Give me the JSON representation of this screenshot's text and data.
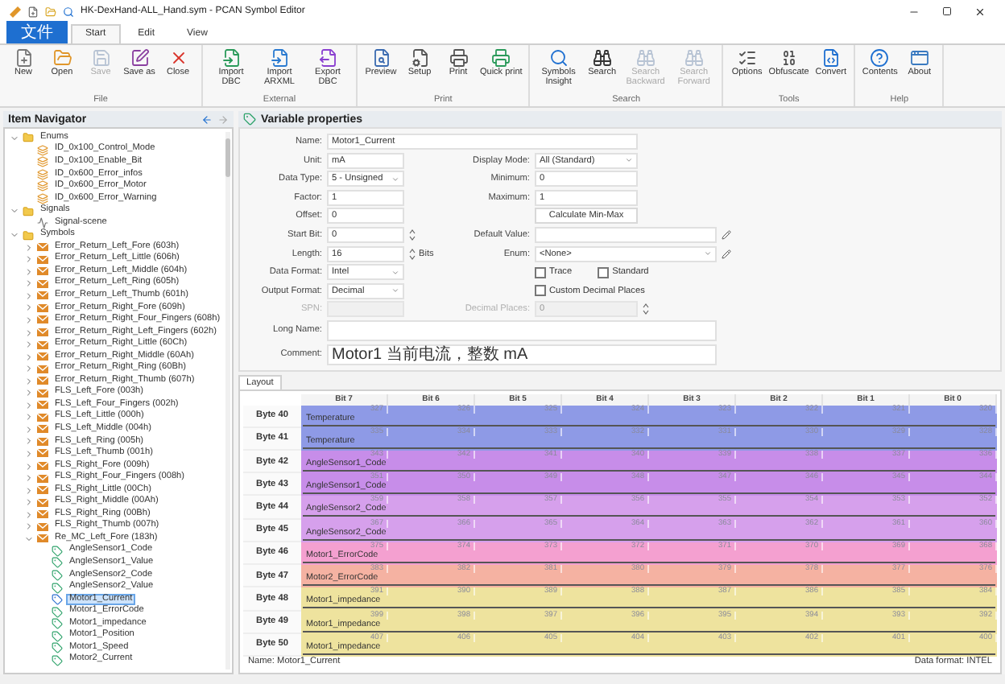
{
  "window": {
    "title": "HK-DexHand-ALL_Hand.sym - PCAN Symbol Editor"
  },
  "ribbon": {
    "tabs": [
      {
        "label": "文件",
        "kind": "file",
        "selected": false
      },
      {
        "label": "Start",
        "kind": "tab",
        "selected": true
      },
      {
        "label": "Edit",
        "kind": "tab",
        "selected": false
      },
      {
        "label": "View",
        "kind": "tab",
        "selected": false
      }
    ],
    "groups": [
      {
        "label": "File",
        "buttons": [
          {
            "label": "New",
            "disabled": false
          },
          {
            "label": "Open",
            "disabled": false
          },
          {
            "label": "Save",
            "disabled": true
          },
          {
            "label": "Save as",
            "disabled": false
          },
          {
            "label": "Close",
            "disabled": false
          }
        ]
      },
      {
        "label": "External",
        "buttons": [
          {
            "label": "Import DBC",
            "disabled": false
          },
          {
            "label": "Import ARXML",
            "disabled": false
          },
          {
            "label": "Export DBC",
            "disabled": false
          }
        ]
      },
      {
        "label": "Print",
        "buttons": [
          {
            "label": "Preview",
            "disabled": false
          },
          {
            "label": "Setup",
            "disabled": false
          },
          {
            "label": "Print",
            "disabled": false
          },
          {
            "label": "Quick print",
            "disabled": false
          }
        ]
      },
      {
        "label": "Search",
        "buttons": [
          {
            "label": "Symbols Insight",
            "disabled": false
          },
          {
            "label": "Search",
            "disabled": false
          },
          {
            "label": "Search Backward",
            "disabled": true
          },
          {
            "label": "Search Forward",
            "disabled": true
          }
        ]
      },
      {
        "label": "Tools",
        "buttons": [
          {
            "label": "Options",
            "disabled": false
          },
          {
            "label": "Obfuscate",
            "disabled": false
          },
          {
            "label": "Convert",
            "disabled": false
          }
        ]
      },
      {
        "label": "Help",
        "buttons": [
          {
            "label": "Contents",
            "disabled": false
          },
          {
            "label": "About",
            "disabled": false
          }
        ]
      }
    ]
  },
  "navigator": {
    "title": "Item Navigator",
    "tree": [
      {
        "label": "Enums",
        "kind": "folder",
        "expanded": true,
        "children": [
          {
            "label": "ID_0x100_Control_Mode",
            "kind": "enum"
          },
          {
            "label": "ID_0x100_Enable_Bit",
            "kind": "enum"
          },
          {
            "label": "ID_0x600_Error_infos",
            "kind": "enum"
          },
          {
            "label": "ID_0x600_Error_Motor",
            "kind": "enum"
          },
          {
            "label": "ID_0x600_Error_Warning",
            "kind": "enum"
          }
        ]
      },
      {
        "label": "Signals",
        "kind": "folder",
        "expanded": true,
        "children": [
          {
            "label": "Signal-scene",
            "kind": "signal"
          }
        ]
      },
      {
        "label": "Symbols",
        "kind": "folder",
        "expanded": true,
        "children": [
          {
            "label": "Error_Return_Left_Fore (603h)",
            "kind": "symbol",
            "expanded": false
          },
          {
            "label": "Error_Return_Left_Little (606h)",
            "kind": "symbol",
            "expanded": false
          },
          {
            "label": "Error_Return_Left_Middle (604h)",
            "kind": "symbol",
            "expanded": false
          },
          {
            "label": "Error_Return_Left_Ring (605h)",
            "kind": "symbol",
            "expanded": false
          },
          {
            "label": "Error_Return_Left_Thumb (601h)",
            "kind": "symbol",
            "expanded": false
          },
          {
            "label": "Error_Return_Right_Fore (609h)",
            "kind": "symbol",
            "expanded": false
          },
          {
            "label": "Error_Return_Right_Four_Fingers (608h)",
            "kind": "symbol",
            "expanded": false
          },
          {
            "label": "Error_Return_Right_Left_Fingers (602h)",
            "kind": "symbol",
            "expanded": false
          },
          {
            "label": "Error_Return_Right_Little (60Ch)",
            "kind": "symbol",
            "expanded": false
          },
          {
            "label": "Error_Return_Right_Middle (60Ah)",
            "kind": "symbol",
            "expanded": false
          },
          {
            "label": "Error_Return_Right_Ring (60Bh)",
            "kind": "symbol",
            "expanded": false
          },
          {
            "label": "Error_Return_Right_Thumb (607h)",
            "kind": "symbol",
            "expanded": false
          },
          {
            "label": "FLS_Left_Fore (003h)",
            "kind": "symbol",
            "expanded": false
          },
          {
            "label": "FLS_Left_Four_Fingers (002h)",
            "kind": "symbol",
            "expanded": false
          },
          {
            "label": "FLS_Left_Little (000h)",
            "kind": "symbol",
            "expanded": false
          },
          {
            "label": "FLS_Left_Middle (004h)",
            "kind": "symbol",
            "expanded": false
          },
          {
            "label": "FLS_Left_Ring (005h)",
            "kind": "symbol",
            "expanded": false
          },
          {
            "label": "FLS_Left_Thumb (001h)",
            "kind": "symbol",
            "expanded": false
          },
          {
            "label": "FLS_Right_Fore (009h)",
            "kind": "symbol",
            "expanded": false
          },
          {
            "label": "FLS_Right_Four_Fingers (008h)",
            "kind": "symbol",
            "expanded": false
          },
          {
            "label": "FLS_Right_Little (00Ch)",
            "kind": "symbol",
            "expanded": false
          },
          {
            "label": "FLS_Right_Middle (00Ah)",
            "kind": "symbol",
            "expanded": false
          },
          {
            "label": "FLS_Right_Ring (00Bh)",
            "kind": "symbol",
            "expanded": false
          },
          {
            "label": "FLS_Right_Thumb (007h)",
            "kind": "symbol",
            "expanded": false
          },
          {
            "label": "Re_MC_Left_Fore (183h)",
            "kind": "symbol",
            "expanded": true,
            "children": [
              {
                "label": "AngleSensor1_Code",
                "kind": "variable",
                "selected": false
              },
              {
                "label": "AngleSensor1_Value",
                "kind": "variable",
                "selected": false
              },
              {
                "label": "AngleSensor2_Code",
                "kind": "variable",
                "selected": false
              },
              {
                "label": "AngleSensor2_Value",
                "kind": "variable",
                "selected": false
              },
              {
                "label": "Motor1_Current",
                "kind": "variable",
                "selected": true
              },
              {
                "label": "Motor1_ErrorCode",
                "kind": "variable",
                "selected": false
              },
              {
                "label": "Motor1_impedance",
                "kind": "variable",
                "selected": false
              },
              {
                "label": "Motor1_Position",
                "kind": "variable",
                "selected": false
              },
              {
                "label": "Motor1_Speed",
                "kind": "variable",
                "selected": false
              },
              {
                "label": "Motor2_Current",
                "kind": "variable",
                "selected": false
              }
            ]
          }
        ]
      }
    ]
  },
  "properties": {
    "title": "Variable properties",
    "rows": [
      [
        {
          "kind": "wide",
          "label": "Name:",
          "value": "Motor1_Current"
        }
      ],
      [
        {
          "kind": "text",
          "label": "Unit:",
          "value": "mA"
        },
        {
          "kind": "select",
          "label": "Display Mode:",
          "value": "All (Standard)"
        }
      ],
      [
        {
          "kind": "select",
          "label": "Data Type:",
          "value": "5 - Unsigned"
        },
        {
          "kind": "text",
          "label": "Minimum:",
          "value": "0"
        }
      ],
      [
        {
          "kind": "text",
          "label": "Factor:",
          "value": "1"
        },
        {
          "kind": "text",
          "label": "Maximum:",
          "value": "1"
        }
      ],
      [
        {
          "kind": "text",
          "label": "Offset:",
          "value": "0"
        },
        {
          "kind": "button",
          "label": "Calculate Min-Max"
        }
      ],
      [
        {
          "kind": "spin",
          "label": "Start Bit:",
          "value": "0"
        },
        {
          "kind": "longtext",
          "label": "Default Value:"
        }
      ],
      [
        {
          "kind": "spin",
          "label": "Length:",
          "value": "16",
          "unit": "Bits"
        },
        {
          "kind": "longselect",
          "label": "Enum:",
          "value": "<None>"
        }
      ],
      [
        {
          "kind": "select",
          "label": "Data Format:",
          "value": "Intel"
        },
        {
          "kind": "checks",
          "items": [
            {
              "label": "Trace",
              "checked": false
            },
            {
              "label": "Standard",
              "checked": false
            }
          ]
        }
      ],
      [
        {
          "kind": "select",
          "label": "Output Format:",
          "value": "Decimal"
        },
        {
          "kind": "checks",
          "items": [
            {
              "label": "Custom Decimal Places",
              "checked": false
            }
          ]
        }
      ],
      [
        {
          "kind": "text",
          "label": "SPN:",
          "disabled": true
        },
        {
          "kind": "spin",
          "label": "Decimal Places:",
          "value": "0",
          "disabled": true
        }
      ],
      [
        {
          "kind": "wider",
          "label": "Long Name:"
        }
      ],
      [
        {
          "kind": "wider",
          "label": "Comment:",
          "value": "Motor1 当前电流，整数 mA"
        }
      ]
    ]
  },
  "layout": {
    "tab": "Layout",
    "columns": [
      "Bit 7",
      "Bit 6",
      "Bit 5",
      "Bit 4",
      "Bit 3",
      "Bit 2",
      "Bit 1",
      "Bit 0"
    ],
    "rows": [
      {
        "label": "Byte 40",
        "signal": "Temperature",
        "color": "#8e9ae6",
        "bits": [
          "327",
          "326",
          "325",
          "324",
          "323",
          "322",
          "321",
          "320"
        ]
      },
      {
        "label": "Byte 41",
        "signal": "Temperature",
        "color": "#8e9ae6",
        "bits": [
          "335",
          "334",
          "333",
          "332",
          "331",
          "330",
          "329",
          "328"
        ]
      },
      {
        "label": "Byte 42",
        "signal": "AngleSensor1_Code",
        "color": "#c78de9",
        "bits": [
          "343",
          "342",
          "341",
          "340",
          "339",
          "338",
          "337",
          "336"
        ]
      },
      {
        "label": "Byte 43",
        "signal": "AngleSensor1_Code",
        "color": "#c78de9",
        "bits": [
          "351",
          "350",
          "349",
          "348",
          "347",
          "346",
          "345",
          "344"
        ]
      },
      {
        "label": "Byte 44",
        "signal": "AngleSensor2_Code",
        "color": "#d6a0ec",
        "bits": [
          "359",
          "358",
          "357",
          "356",
          "355",
          "354",
          "353",
          "352"
        ]
      },
      {
        "label": "Byte 45",
        "signal": "AngleSensor2_Code",
        "color": "#d6a0ec",
        "bits": [
          "367",
          "366",
          "365",
          "364",
          "363",
          "362",
          "361",
          "360"
        ]
      },
      {
        "label": "Byte 46",
        "signal": "Motor1_ErrorCode",
        "color": "#f4a0d0",
        "bits": [
          "375",
          "374",
          "373",
          "372",
          "371",
          "370",
          "369",
          "368"
        ]
      },
      {
        "label": "Byte 47",
        "signal": "Motor2_ErrorCode",
        "color": "#f5b2a2",
        "bits": [
          "383",
          "382",
          "381",
          "380",
          "379",
          "378",
          "377",
          "376"
        ]
      },
      {
        "label": "Byte 48",
        "signal": "Motor1_impedance",
        "color": "#eee39e",
        "bits": [
          "391",
          "390",
          "389",
          "388",
          "387",
          "386",
          "385",
          "384"
        ]
      },
      {
        "label": "Byte 49",
        "signal": "Motor1_impedance",
        "color": "#eee39e",
        "bits": [
          "399",
          "398",
          "397",
          "396",
          "395",
          "394",
          "393",
          "392"
        ]
      },
      {
        "label": "Byte 50",
        "signal": "Motor1_impedance",
        "color": "#eee39e",
        "bits": [
          "407",
          "406",
          "405",
          "404",
          "403",
          "402",
          "401",
          "400"
        ]
      }
    ]
  },
  "status": {
    "name": "Name: Motor1_Current",
    "format": "Data format: INTEL"
  }
}
